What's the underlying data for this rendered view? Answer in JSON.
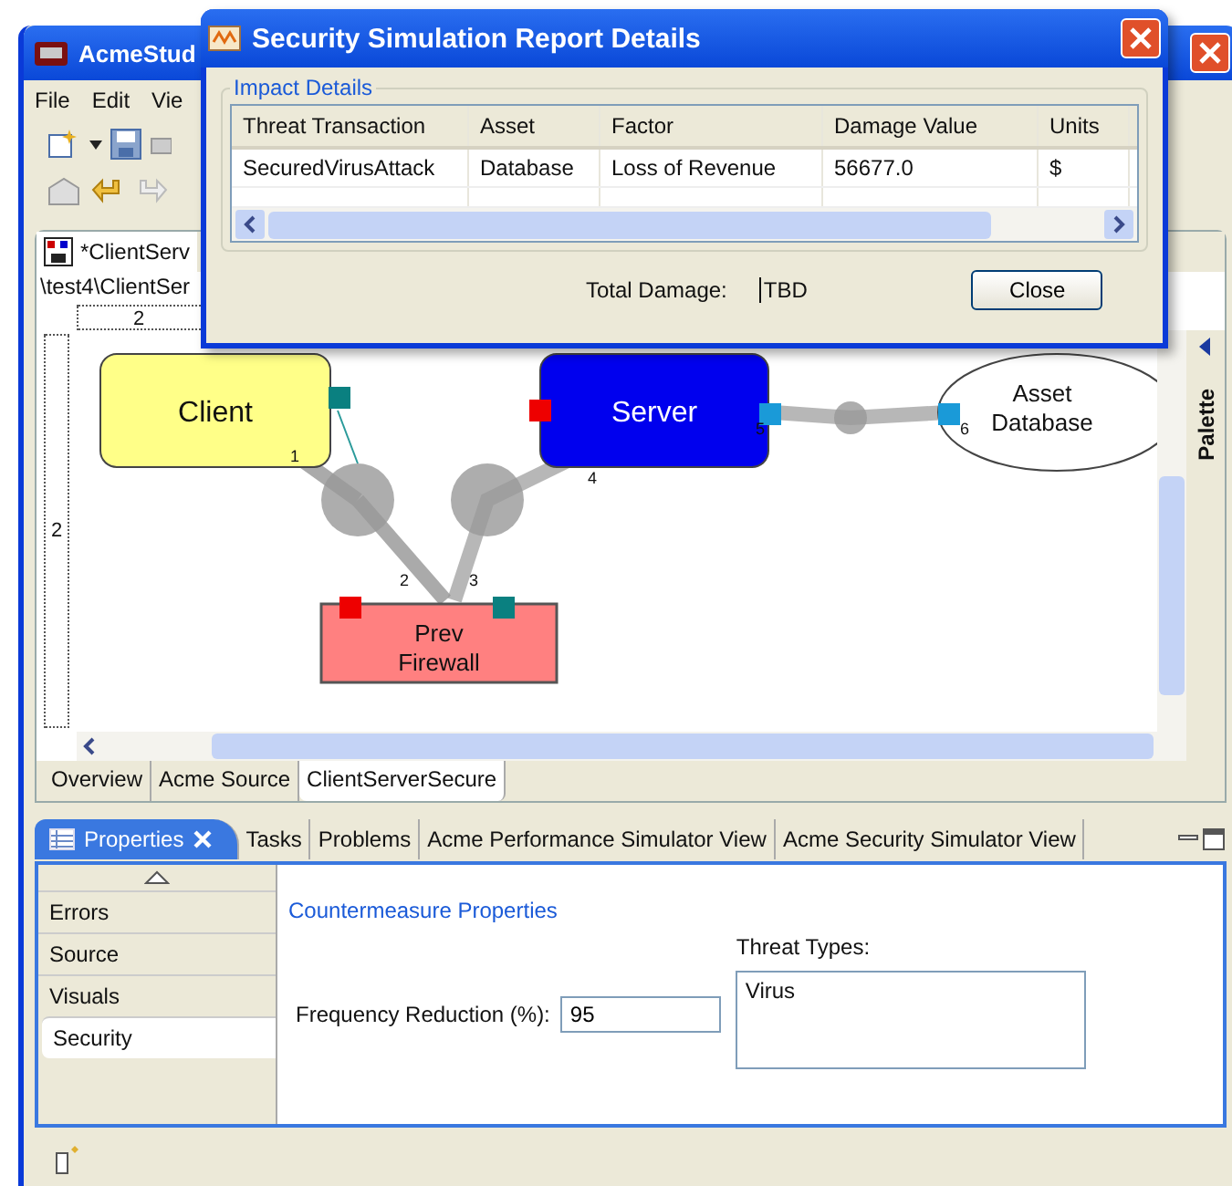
{
  "main_window": {
    "title": "AcmeStud"
  },
  "menu": [
    "File",
    "Edit",
    "Vie"
  ],
  "editor": {
    "tab": "*ClientServ",
    "path": "\\test4\\ClientSer",
    "ruler_label": "2",
    "side_ruler_label": "2"
  },
  "diagram": {
    "nodes": [
      {
        "kind": "box",
        "lines": [
          "Client"
        ],
        "color": "#ffff88"
      },
      {
        "kind": "box",
        "lines": [
          "Server"
        ],
        "color": "#0000ee"
      },
      {
        "kind": "ellipse",
        "lines": [
          "Asset",
          "Database"
        ],
        "color": "#ffffff"
      },
      {
        "kind": "firewall",
        "lines": [
          "Prev",
          "Firewall"
        ],
        "color": "#ff8080"
      }
    ],
    "links": [
      {
        "label": "1"
      },
      {
        "label": "2"
      },
      {
        "label": "3"
      },
      {
        "label": "4"
      },
      {
        "label": "5"
      },
      {
        "label": "6"
      }
    ]
  },
  "palette": {
    "label": "Palette"
  },
  "editor_tabs": [
    {
      "label": "Overview",
      "selected": false
    },
    {
      "label": "Acme Source",
      "selected": false
    },
    {
      "label": "ClientServerSecure",
      "selected": true
    }
  ],
  "properties_view": {
    "tabs": [
      {
        "label": "Properties",
        "selected": true
      },
      {
        "label": "Tasks",
        "selected": false
      },
      {
        "label": "Problems",
        "selected": false
      },
      {
        "label": "Acme Performance Simulator View",
        "selected": false
      },
      {
        "label": "Acme Security Simulator View",
        "selected": false
      }
    ],
    "categories": [
      {
        "label": "Errors",
        "selected": false
      },
      {
        "label": "Source",
        "selected": false
      },
      {
        "label": "Visuals",
        "selected": false
      },
      {
        "label": "Security",
        "selected": true
      }
    ],
    "section_title": "Countermeasure Properties",
    "frequency_label": "Frequency Reduction (%):",
    "frequency_value": "95",
    "threat_types_label": "Threat Types:",
    "threat_types_value": "Virus"
  },
  "dialog": {
    "title": "Security Simulation Report Details",
    "group": "Impact Details",
    "columns": [
      "Threat Transaction",
      "Asset",
      "Factor",
      "Damage Value",
      "Units"
    ],
    "rows": [
      [
        "SecuredVirusAttack",
        "Database",
        "Loss of Revenue",
        "56677.0",
        "$"
      ]
    ],
    "total_label": "Total Damage:",
    "total_value": "TBD",
    "close_button": "Close"
  }
}
